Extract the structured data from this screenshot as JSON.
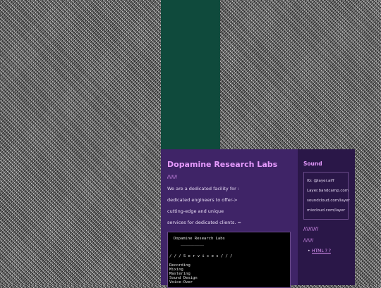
{
  "main": {
    "title": "Dopamine Research Labs",
    "deco": "///////",
    "description_lines": [
      "We are a dedicated facility for :",
      "dedicated engineers to offer->",
      "cutting-edge and unique",
      "services for dedicated clients. ="
    ],
    "terminal": {
      "heading": "Dopamine Research Labs",
      "rule": "__________",
      "services_heading": "/ / / S e r v i c e s / / /",
      "services": [
        "Recording",
        "Mixing",
        "Mastering",
        "Sound Design",
        "Voice-Over"
      ]
    }
  },
  "sidebar": {
    "title": "Sound",
    "links": [
      "IG: @layer.aiff",
      "Layer.bandcamp.com",
      "soundcloud.com/layer",
      "mixcloud.com/layer"
    ],
    "deco1": "/////////",
    "deco2": "///////",
    "list_items": [
      "HTML ? ?"
    ]
  },
  "colors": {
    "accent": "#e79bff",
    "main_panel": "#3f2467",
    "side_panel": "#2a1748",
    "green_column": "#0f4a3c"
  }
}
